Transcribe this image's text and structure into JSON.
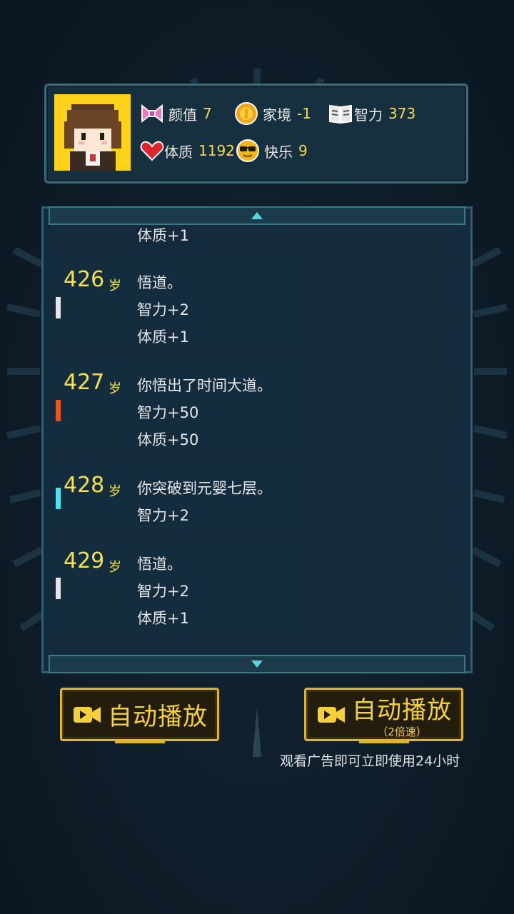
{
  "stats": {
    "looks": {
      "label": "颜值",
      "value": "7",
      "icon": "bow-icon"
    },
    "family": {
      "label": "家境",
      "value": "-1",
      "icon": "coin-icon"
    },
    "intellect": {
      "label": "智力",
      "value": "373",
      "icon": "book-icon"
    },
    "physique": {
      "label": "体质",
      "value": "1192",
      "icon": "heart-icon"
    },
    "happiness": {
      "label": "快乐",
      "value": "9",
      "icon": "sunglasses-face-icon"
    }
  },
  "log": {
    "partial_top": "体质+1",
    "entries": [
      {
        "age": "426",
        "unit": "岁",
        "marker_color": "#e6e6e6",
        "lines": [
          "悟道。",
          "智力+2",
          "体质+1"
        ]
      },
      {
        "age": "427",
        "unit": "岁",
        "marker_color": "#e8541c",
        "lines": [
          "你悟出了时间大道。",
          "智力+50",
          "体质+50"
        ]
      },
      {
        "age": "428",
        "unit": "岁",
        "marker_color": "#4fe3ee",
        "lines": [
          "你突破到元婴七层。",
          "智力+2"
        ]
      },
      {
        "age": "429",
        "unit": "岁",
        "marker_color": "#e6e6e6",
        "lines": [
          "悟道。",
          "智力+2",
          "体质+1"
        ]
      }
    ]
  },
  "buttons": {
    "autoplay_label": "自动播放",
    "autoplay2x_label": "自动播放",
    "autoplay2x_sub": "（2倍速）"
  },
  "ad_note": "观看广告即可立即使用24小时",
  "colors": {
    "accent_gold": "#f5d03b",
    "value_yellow": "#f5dd4b",
    "panel_border": "#3a6e7a"
  }
}
